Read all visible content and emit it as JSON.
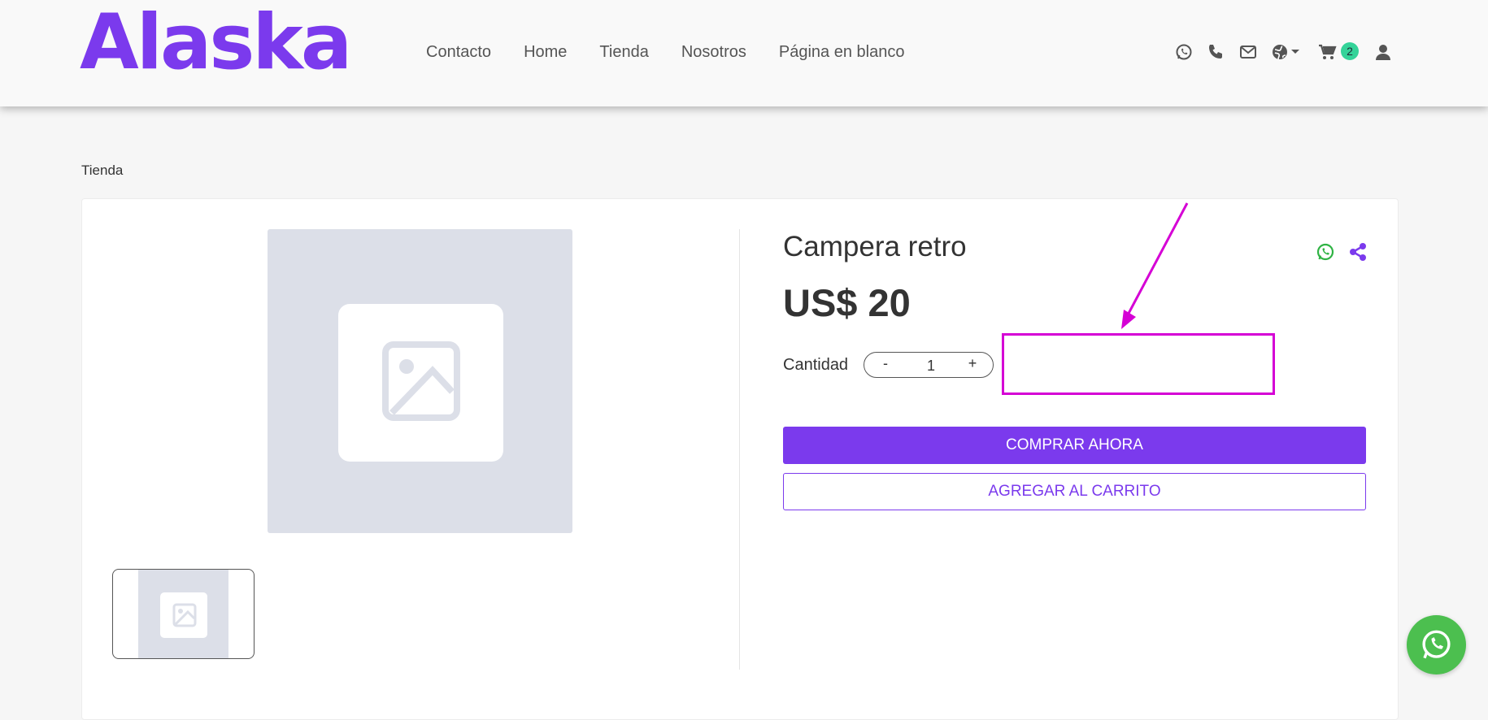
{
  "brand": {
    "logo_text": "Alaska",
    "accent_color": "#7b3aed"
  },
  "nav": {
    "items": [
      "Contacto",
      "Home",
      "Tienda",
      "Nosotros",
      "Página en blanco"
    ]
  },
  "header_icons": {
    "whatsapp": "whatsapp-icon",
    "phone": "phone-icon",
    "email": "email-icon",
    "language": "globe-icon",
    "cart": "cart-icon",
    "user": "user-icon",
    "cart_count": "2"
  },
  "breadcrumb": {
    "label": "Tienda"
  },
  "product": {
    "title": "Campera retro",
    "price": "US$ 20",
    "quantity_label": "Cantidad",
    "quantity_value": "1",
    "minus_label": "-",
    "plus_label": "+",
    "buy_now_label": "COMPRAR AHORA",
    "add_to_cart_label": "AGREGAR AL CARRITO"
  },
  "colors": {
    "whatsapp_green": "#4cbf4f",
    "badge_green": "#34d399",
    "annotation_magenta": "#d500d5"
  }
}
